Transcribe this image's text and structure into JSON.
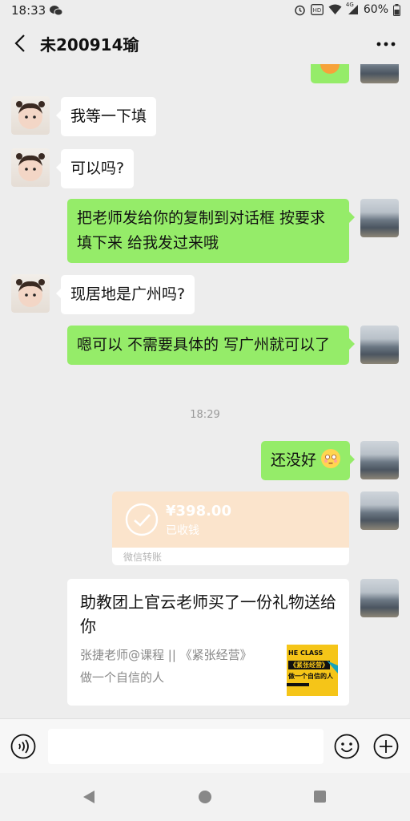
{
  "status_bar": {
    "time": "18:33",
    "network": "4G",
    "battery": "60%",
    "icons": [
      "wechat-icon",
      "alarm-icon",
      "hd-icon",
      "wifi-icon",
      "signal-icon",
      "battery-icon"
    ]
  },
  "header": {
    "title": "未200914瑜",
    "back_icon": "back-arrow-icon",
    "more_icon": "more-icon"
  },
  "messages": [
    {
      "side": "left",
      "text": "我等一下填"
    },
    {
      "side": "left",
      "text": "可以吗?"
    },
    {
      "side": "right",
      "text": "把老师发给你的复制到对话框 按要求填下来 给我发过来哦"
    },
    {
      "side": "left",
      "text": "现居地是广州吗?"
    },
    {
      "side": "right",
      "text": "嗯可以 不需要具体的 写广州就可以了"
    },
    {
      "side": "right",
      "text": "还没好",
      "emoji": "flushed-face-emoji"
    }
  ],
  "timestamp": "18:29",
  "transfer": {
    "amount": "¥398.00",
    "status": "已收钱",
    "footer": "微信转账",
    "icon": "check-circle-icon"
  },
  "gift": {
    "title": "助教团上官云老师买了一份礼物送给你",
    "desc_line1": "张捷老师@课程 || 《紧张经营》",
    "desc_line2": "做一个自信的人",
    "thumb_lines": [
      "HE CLASS",
      "《紧张经营》",
      "做一个自信的人"
    ]
  },
  "input": {
    "value": "",
    "placeholder": ""
  },
  "colors": {
    "background": "#ededed",
    "bubble_right": "#95ec69",
    "bubble_left": "#ffffff",
    "transfer_received": "#fbe4cc"
  }
}
